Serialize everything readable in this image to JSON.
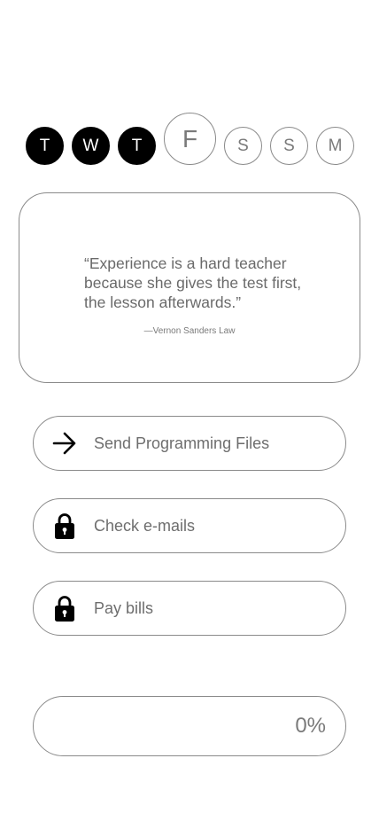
{
  "week": {
    "days": [
      {
        "letter": "T",
        "state": "done"
      },
      {
        "letter": "W",
        "state": "done"
      },
      {
        "letter": "T",
        "state": "done"
      },
      {
        "letter": "F",
        "state": "today"
      },
      {
        "letter": "S",
        "state": "todo"
      },
      {
        "letter": "S",
        "state": "todo"
      },
      {
        "letter": "M",
        "state": "todo"
      }
    ]
  },
  "quote": {
    "text": "“Experience is a hard teacher because she gives the test first, the lesson afterwards.”",
    "author": "—Vernon Sanders Law"
  },
  "tasks": [
    {
      "label": "Send Programming Files",
      "icon": "arrow-right-icon",
      "locked": false
    },
    {
      "label": "Check e-mails",
      "icon": "padlock-icon",
      "locked": true
    },
    {
      "label": "Pay bills",
      "icon": "padlock-icon",
      "locked": true
    }
  ],
  "progress": {
    "label": "0%",
    "fraction": 0
  },
  "colors": {
    "done_fill": "#000000",
    "outline": "#8a8a8a",
    "text": "#6e6e6e",
    "background": "#ffffff"
  }
}
